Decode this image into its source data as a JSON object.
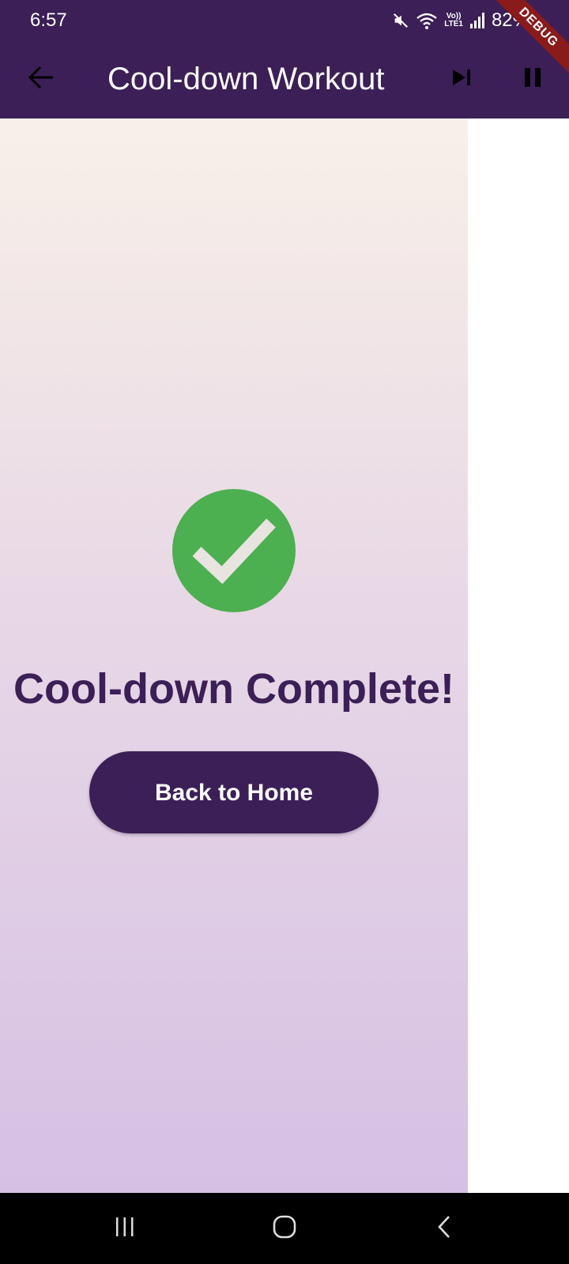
{
  "status_bar": {
    "time": "6:57",
    "lte_top": "Vo))",
    "lte_bottom": "LTE1",
    "battery": "82%"
  },
  "app_bar": {
    "title": "Cool-down Workout",
    "back_icon": "arrow-back-icon",
    "skip_icon": "skip-next-icon",
    "pause_icon": "pause-icon"
  },
  "debug_banner": "DEBUG",
  "main": {
    "status_icon": "check-circle-icon",
    "title": "Cool-down Complete!",
    "back_home_label": "Back to Home"
  },
  "nav": {
    "recents_icon": "recents-icon",
    "home_icon": "home-icon",
    "back_icon": "back-chevron-icon"
  },
  "colors": {
    "primary": "#3b1f56",
    "success": "#4caf50",
    "gradient_top": "#f8f0e8",
    "gradient_bottom": "#d6c0e4"
  }
}
